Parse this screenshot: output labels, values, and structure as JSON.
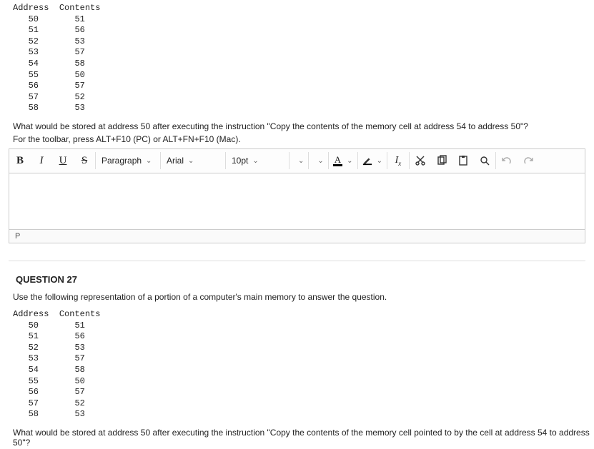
{
  "memory": {
    "header_addr": "Address",
    "header_cont": "Contents",
    "rows": [
      {
        "a": "50",
        "c": "51"
      },
      {
        "a": "51",
        "c": "56"
      },
      {
        "a": "52",
        "c": "53"
      },
      {
        "a": "53",
        "c": "57"
      },
      {
        "a": "54",
        "c": "58"
      },
      {
        "a": "55",
        "c": "50"
      },
      {
        "a": "56",
        "c": "57"
      },
      {
        "a": "57",
        "c": "52"
      },
      {
        "a": "58",
        "c": "53"
      }
    ]
  },
  "q_prev": {
    "text": "What would be stored at address 50 after executing the instruction \"Copy the contents of the memory cell at address 54 to address 50\"?",
    "hint": "For the toolbar, press ALT+F10 (PC) or ALT+FN+F10 (Mac)."
  },
  "toolbar": {
    "paragraph": "Paragraph",
    "font": "Arial",
    "size": "10pt",
    "text_color_glyph": "A",
    "remove_fmt": "x",
    "status": "P"
  },
  "q27": {
    "header": "QUESTION 27",
    "intro": "Use the following representation of a portion of a computer's main memory to answer the question.",
    "text": "What would be stored at address 50 after executing the instruction \"Copy the contents of the memory cell pointed to by the cell at address 54 to address 50\"?"
  }
}
